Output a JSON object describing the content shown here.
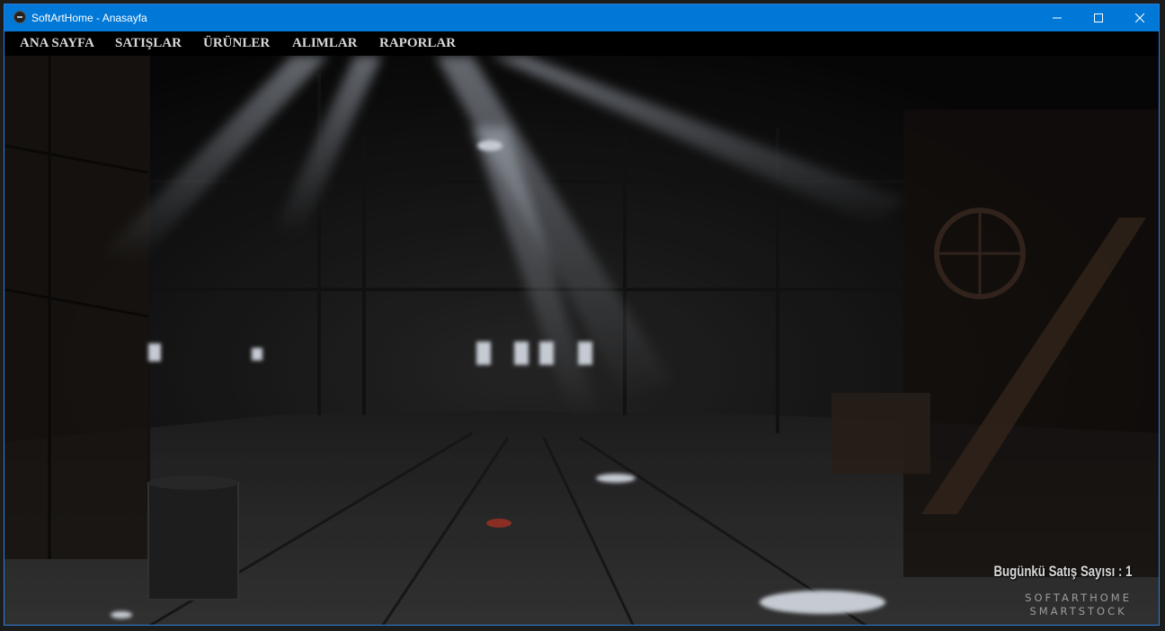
{
  "window": {
    "title": "SoftArtHome - Anasayfa",
    "controls": {
      "minimize": "minimize-icon",
      "maximize": "maximize-icon",
      "close": "close-icon"
    },
    "accent_color": "#0078d7"
  },
  "menu": {
    "items": [
      {
        "label": "ANA SAYFA"
      },
      {
        "label": "SATIŞLAR"
      },
      {
        "label": "ÜRÜNLER"
      },
      {
        "label": "ALIMLAR"
      },
      {
        "label": "RAPORLAR"
      }
    ]
  },
  "main": {
    "status_text": "Bugünkü Satış Sayısı : 1",
    "brand_line1": "SOFTARTHOME",
    "brand_line2": "SMARTSTOCK"
  }
}
